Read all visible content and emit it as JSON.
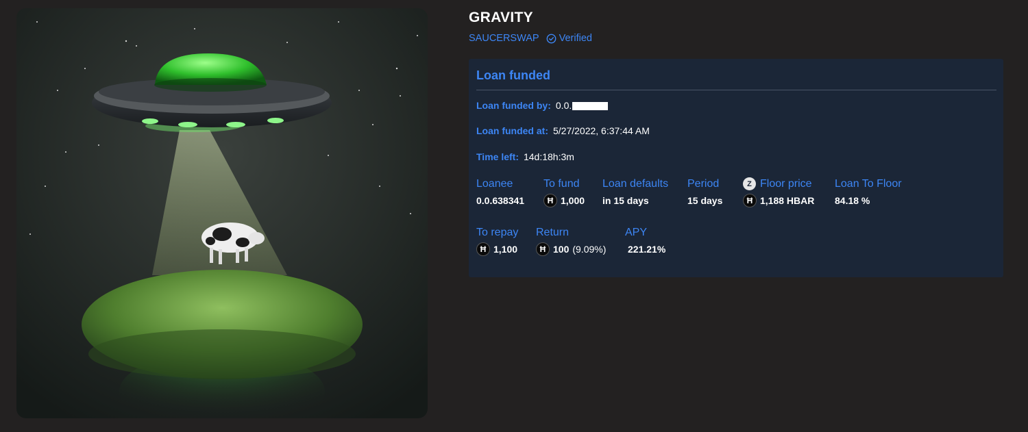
{
  "nft": {
    "image_icon": "ufo-abducting-cow-artwork",
    "title": "GRAVITY",
    "collection": "SAUCERSWAP",
    "verified_label": "Verified",
    "verified_icon": "check-circle-icon"
  },
  "loan": {
    "status_title": "Loan funded",
    "funded_by_label": "Loan funded by:",
    "funded_by_value": "0.0.",
    "funded_at_label": "Loan funded at:",
    "funded_at_value": "5/27/2022, 6:37:44 AM",
    "time_left_label": "Time left:",
    "time_left_value": "14d:18h:3m",
    "stats": {
      "loanee": {
        "label": "Loanee",
        "value": "0.0.638341"
      },
      "to_fund": {
        "label": "To fund",
        "value": "1,000",
        "icon": "hbar-icon"
      },
      "loan_defaults": {
        "label": "Loan defaults",
        "value": "in 15 days"
      },
      "period": {
        "label": "Period",
        "value": "15 days"
      },
      "floor_price": {
        "label": "Floor price",
        "value": "1,188 HBAR",
        "label_icon": "zuse-icon",
        "icon": "hbar-icon"
      },
      "loan_to_floor": {
        "label": "Loan To Floor",
        "value": "84.18 %"
      },
      "to_repay": {
        "label": "To repay",
        "value": "1,100",
        "icon": "hbar-icon"
      },
      "return": {
        "label": "Return",
        "value": "100",
        "percent": "(9.09%)",
        "icon": "hbar-icon"
      },
      "apy": {
        "label": "APY",
        "value": "221.21%"
      }
    }
  },
  "colors": {
    "page_bg": "#232121",
    "card_bg": "#1b2637",
    "accent_blue": "#3d86f5",
    "text_white": "#ffffff"
  }
}
